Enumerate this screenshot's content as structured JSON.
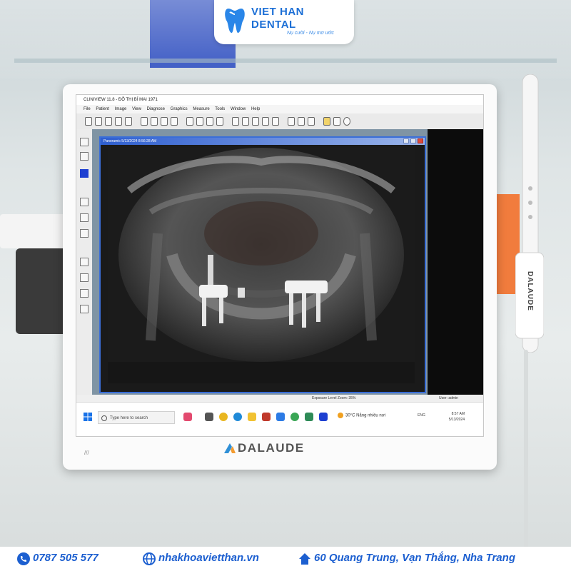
{
  "logo": {
    "name_line1": "VIET HAN",
    "name_line2": "DENTAL",
    "tagline": "Nụ cười - Nụ mơ ước",
    "color": "#1c6fd6"
  },
  "app": {
    "window_title": "CLINIVIEW 11.8 - ĐỖ THỊ BÍ MAI 1971",
    "menu": [
      "File",
      "Patient",
      "Image",
      "View",
      "Diagnose",
      "Graphics",
      "Measure",
      "Tools",
      "Window",
      "Help"
    ],
    "image_window_title": "Panoramic 5/13/2024 8:56:28 AM",
    "status_exposure": "Exposure Level  Zoom: 35%",
    "status_user": "User: admin"
  },
  "taskbar": {
    "search_placeholder": "Type here to search",
    "weather": "30°C  Nắng nhiều nơi",
    "tray_lang": "ENG",
    "clock_time": "8:57 AM",
    "clock_date": "5/13/2024"
  },
  "monitor": {
    "brand": "DALAUDE",
    "marks": "///"
  },
  "camera": {
    "brand": "DALAUDE"
  },
  "contact": {
    "phone": "0787 505 577",
    "website": "nhakhoavietthan.vn",
    "address": "60 Quang Trung, Vạn Thắng, Nha Trang",
    "color": "#1c5fd0"
  },
  "icons": [
    "tooth-logo-icon",
    "windows-start-icon",
    "search-icon",
    "phone-icon",
    "globe-icon",
    "home-icon",
    "weather-sun-icon"
  ]
}
